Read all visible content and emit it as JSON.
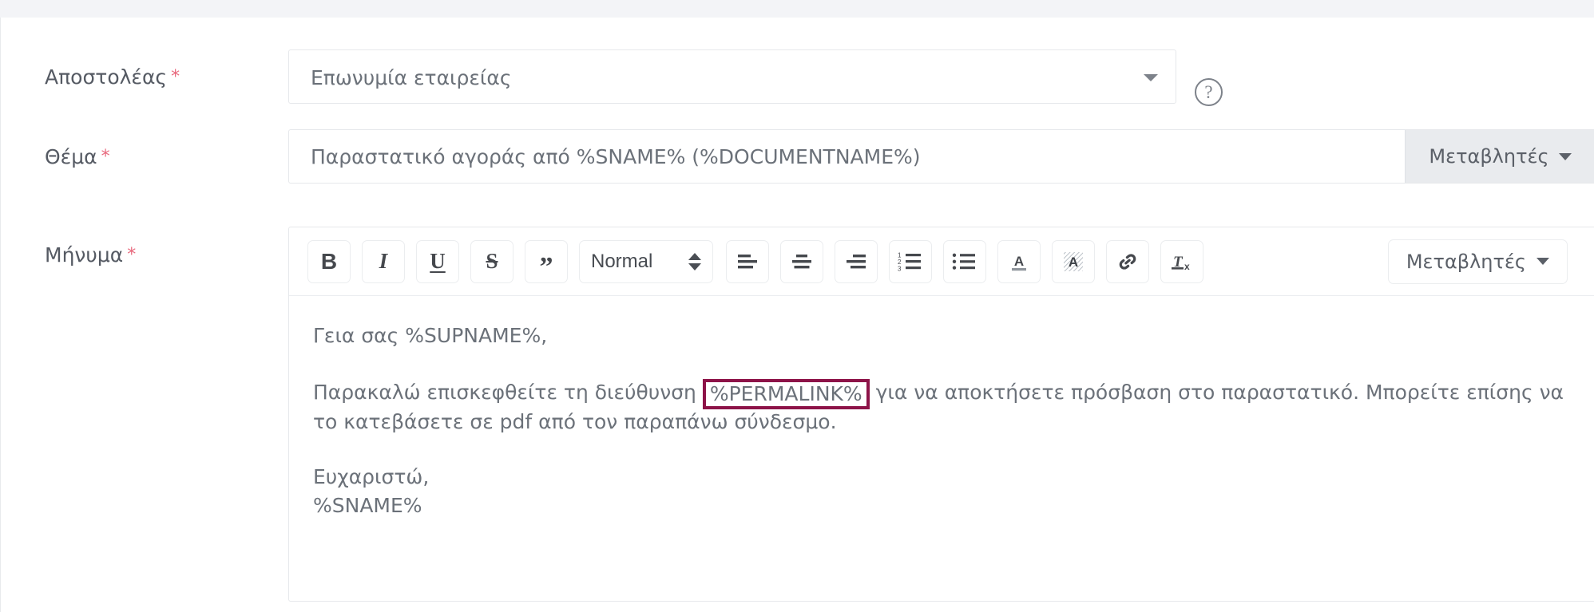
{
  "form": {
    "sender": {
      "label": "Αποστολέας",
      "required_mark": "*",
      "value": "Επωνυμία εταιρείας",
      "dropdown_icon": "chevron-down-icon",
      "help_icon": "question-mark-icon",
      "help_glyph": "?"
    },
    "subject": {
      "label": "Θέμα",
      "required_mark": "*",
      "value": "Παραστατικό αγοράς από %SNAME% (%DOCUMENTNAME%)",
      "placeholder": "",
      "variables_button": "Μεταβλητές"
    },
    "message": {
      "label": "Μήνυμα",
      "required_mark": "*",
      "variables_button": "Μεταβλητές",
      "toolbar": {
        "bold": "B",
        "italic": "I",
        "underline": "U",
        "strikethrough": "S",
        "blockquote": "”",
        "format_select": "Normal",
        "align_left": "align-left-icon",
        "align_center": "align-center-icon",
        "align_right": "align-right-icon",
        "ordered_list": "ordered-list-icon",
        "bullet_list": "bullet-list-icon",
        "text_color": "A",
        "background_color": "A",
        "link": "link-icon",
        "clear_format": "Tx"
      },
      "body": {
        "greeting": "Γεια σας %SUPNAME%,",
        "paragraph_before_link": "Παρακαλώ επισκεφθείτε τη διεύθυνση ",
        "permalink_variable": "%PERMALINK%",
        "paragraph_after_link": " για να αποκτήσετε πρόσβαση στο παραστατικό. Μπορείτε επίσης να το κατεβάσετε σε pdf από τον παραπάνω σύνδεσμο.",
        "signoff": "Ευχαριστώ,",
        "signature_variable": "%SNAME%"
      }
    }
  },
  "colors": {
    "accent_highlight": "#8d1348",
    "required_asterisk": "#e8697d",
    "label_text": "#555a63",
    "field_text": "#6b7179",
    "border": "#e6e8eb",
    "button_bg": "#e9ebee",
    "page_strip": "#f3f4f7"
  }
}
